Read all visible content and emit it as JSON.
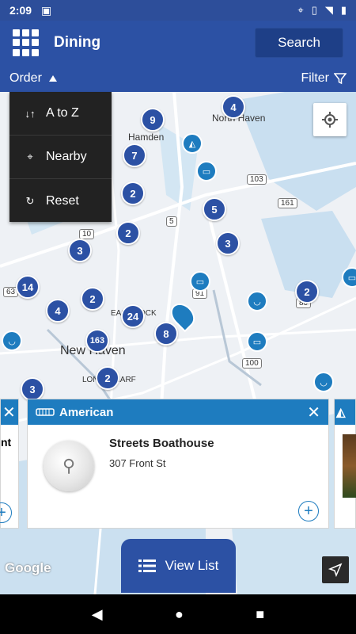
{
  "status": {
    "time": "2:09"
  },
  "appbar": {
    "title": "Dining",
    "search_label": "Search"
  },
  "filterbar": {
    "order_label": "Order",
    "filter_label": "Filter"
  },
  "order_menu": {
    "items": [
      {
        "label": "A to Z"
      },
      {
        "label": "Nearby"
      },
      {
        "label": "Reset"
      }
    ]
  },
  "map": {
    "places": {
      "north_haven": "North Haven",
      "hamden": "Hamden",
      "new_haven": "New Haven",
      "long_wharf": "LONG WHARF",
      "east_rock": "EAST ROCK"
    },
    "shields": [
      "103",
      "161",
      "10",
      "5",
      "91",
      "80",
      "100",
      "63"
    ],
    "clusters": [
      "9",
      "4",
      "7",
      "2",
      "2",
      "5",
      "3",
      "3",
      "14",
      "2",
      "4",
      "24",
      "8",
      "163",
      "2",
      "3",
      "2"
    ],
    "attribution": "Google"
  },
  "card": {
    "category": "American",
    "name": "Streets Boathouse",
    "address": "307 Front St"
  },
  "left_card": {
    "text": "nt"
  },
  "bottom": {
    "view_list_label": "View List"
  },
  "colors": {
    "primary": "#2c51a4",
    "accent": "#1e7cbf"
  }
}
